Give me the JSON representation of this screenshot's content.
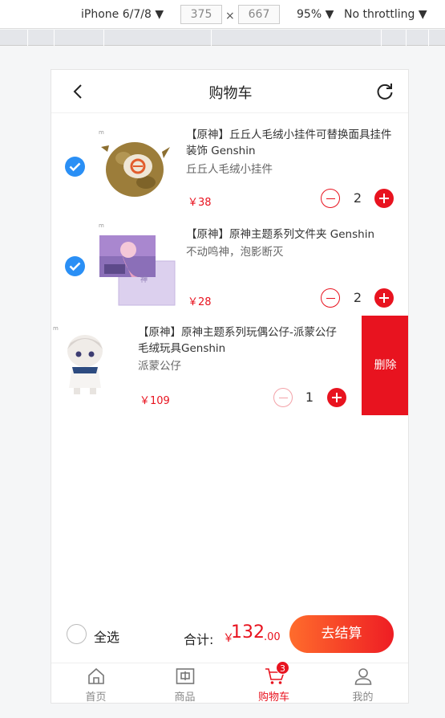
{
  "devtools": {
    "device": "iPhone 6/7/8 ▼",
    "width": "375",
    "times": "×",
    "height": "667",
    "zoom": "95% ▼",
    "throttling": "No throttling ▼"
  },
  "header": {
    "title": "购物车",
    "back_icon": "chevron-left-icon",
    "refresh_icon": "refresh-icon"
  },
  "cart": {
    "items": [
      {
        "name": "【原神】丘丘人毛绒小挂件可替换面具挂件装饰 Genshin",
        "spec": "丘丘人毛绒小挂件",
        "price": "￥38",
        "qty": "2",
        "checked": true
      },
      {
        "name": "【原神】原神主题系列文件夹 Genshin",
        "spec": "不动鸣神，泡影断灭",
        "price": "￥28",
        "qty": "2",
        "checked": true
      },
      {
        "name": "【原神】原神主题系列玩偶公仔-派蒙公仔毛绒玩具Genshin",
        "spec": "派蒙公仔",
        "price": "￥109",
        "qty": "1",
        "checked": false
      }
    ],
    "delete_label": "删除"
  },
  "checkout": {
    "select_all": "全选",
    "total_label": "合计:",
    "currency": "￥",
    "total_int": "132",
    "total_dec": ".00",
    "pay_label": "去结算"
  },
  "tabbar": {
    "tabs": [
      {
        "label": "首页",
        "icon": "home-icon"
      },
      {
        "label": "商品",
        "icon": "goods-icon"
      },
      {
        "label": "购物车",
        "icon": "cart-icon",
        "badge": "3",
        "active": true
      },
      {
        "label": "我的",
        "icon": "user-icon"
      }
    ]
  },
  "colors": {
    "accent": "#e8131f",
    "check": "#2a8ff5",
    "pay_gradient_start": "#ff6c2c",
    "pay_gradient_end": "#ee1d24"
  }
}
